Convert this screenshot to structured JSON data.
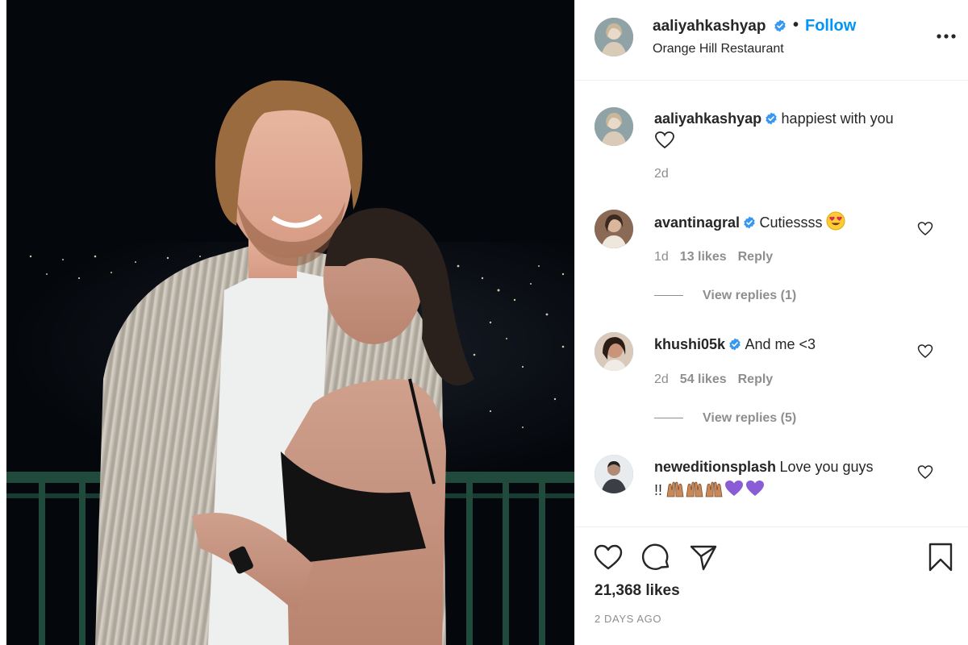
{
  "post": {
    "username": "aaliyahkashyap",
    "follow_label": "Follow",
    "separator": "•",
    "location": "Orange Hill Restaurant",
    "likes": "21,368 likes",
    "time": "2 DAYS AGO"
  },
  "caption": {
    "username": "aaliyahkashyap",
    "text": "happiest with you",
    "emoji_icon": "white-heart-icon",
    "time": "2d"
  },
  "comments": [
    {
      "username": "avantinagral",
      "text": "Cutiessss",
      "emoji_icon": "heart-eyes-emoji-icon",
      "time": "1d",
      "likes": "13 likes",
      "reply_label": "Reply",
      "view_replies": "View replies (1)"
    },
    {
      "username": "khushi05k",
      "text": "And me <3",
      "time": "2d",
      "likes": "54 likes",
      "reply_label": "Reply",
      "view_replies": "View replies (5)"
    },
    {
      "username": "neweditionsplash",
      "text": "Love you guys",
      "text_line2": "!!",
      "emoji_icons": [
        "raised-hands-emoji-icon",
        "raised-hands-emoji-icon",
        "raised-hands-emoji-icon",
        "purple-heart-emoji-icon",
        "purple-heart-emoji-icon"
      ]
    }
  ],
  "icons": {
    "like": "heart-outline-icon",
    "comment": "comment-bubble-icon",
    "share": "paper-plane-icon",
    "save": "bookmark-icon",
    "more": "more-options-icon",
    "verified": "verified-badge-icon"
  },
  "colors": {
    "accent": "#0095f6",
    "verified": "#3897f0",
    "text": "#262626",
    "muted": "#8e8e8e",
    "border": "#efefef",
    "purple_heart": "#8a5cd6"
  }
}
